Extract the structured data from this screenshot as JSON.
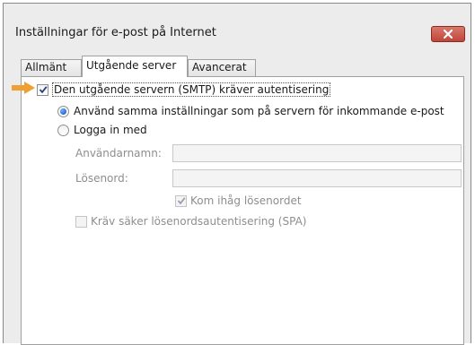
{
  "window": {
    "title": "Inställningar för e-post på Internet"
  },
  "tabs": [
    {
      "label": "Allmänt"
    },
    {
      "label": "Utgående server"
    },
    {
      "label": "Avancerat"
    }
  ],
  "smtp_auth": {
    "label": "Den utgående servern (SMTP) kräver autentisering",
    "checked": true
  },
  "option_same": {
    "label": "Använd samma inställningar som på servern för inkommande e-post",
    "selected": true
  },
  "option_login": {
    "label": "Logga in med",
    "selected": false
  },
  "login": {
    "username_label": "Användarnamn:",
    "username_value": "",
    "password_label": "Lösenord:",
    "password_value": "",
    "remember_label": "Kom ihåg lösenordet",
    "remember_checked": true
  },
  "spa": {
    "label": "Kräv säker lösenordsautentisering (SPA)",
    "checked": false
  },
  "colors": {
    "accent_arrow": "#f0a030",
    "radio_fill": "#0a47b8",
    "close_button": "#c0453a"
  }
}
